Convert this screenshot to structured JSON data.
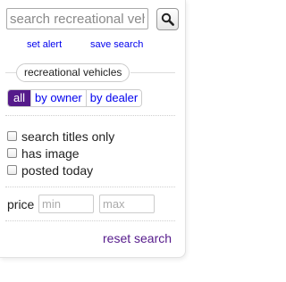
{
  "search": {
    "placeholder": "search recreational vehicles",
    "button_icon": "search-icon"
  },
  "links": {
    "set_alert": "set alert",
    "save_search": "save search"
  },
  "category": {
    "label": "recreational vehicles"
  },
  "seller_filter": {
    "options": [
      "all",
      "by owner",
      "by dealer"
    ],
    "selected": "all"
  },
  "options": [
    {
      "label": "search titles only",
      "checked": false
    },
    {
      "label": "has image",
      "checked": false
    },
    {
      "label": "posted today",
      "checked": false
    }
  ],
  "price": {
    "label": "price",
    "min_placeholder": "min",
    "max_placeholder": "max"
  },
  "reset": {
    "label": "reset search"
  },
  "colors": {
    "link": "#0000ee",
    "selected": "#551a8b",
    "visited_link": "#551a8b"
  }
}
